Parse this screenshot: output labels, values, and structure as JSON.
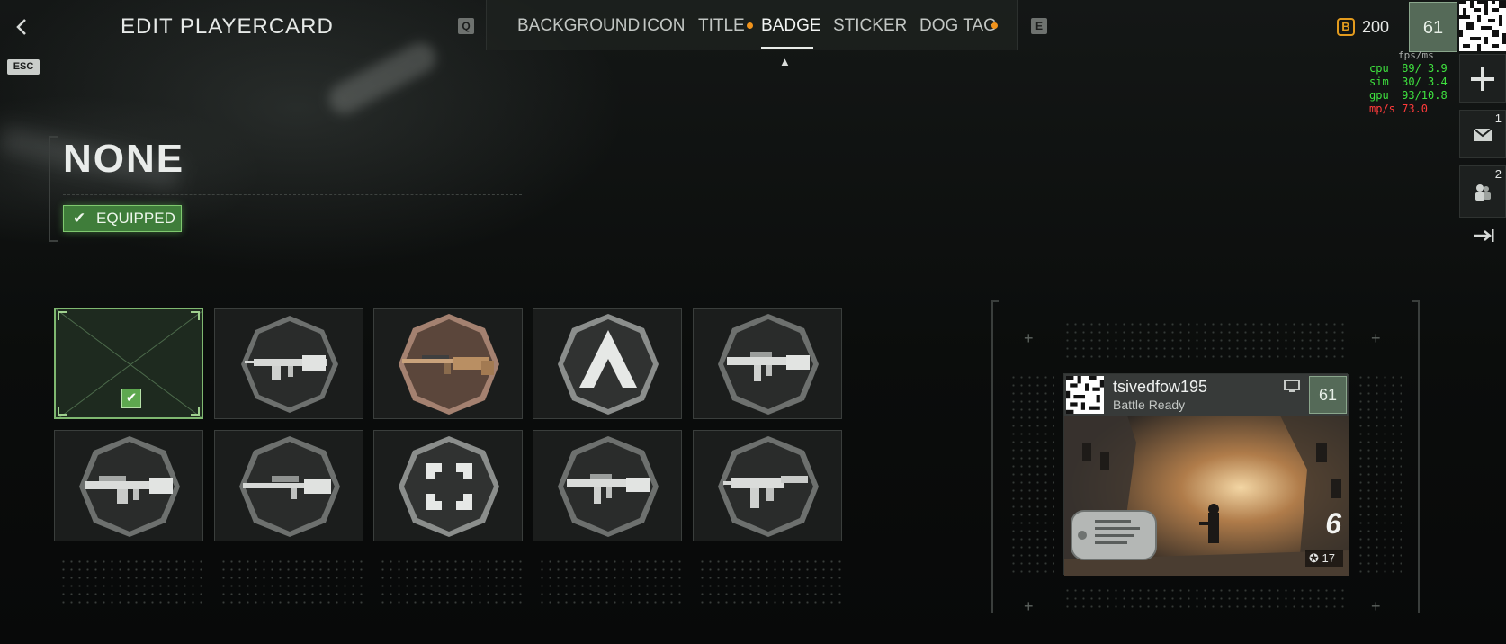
{
  "header": {
    "back_icon": "chevron-left-icon",
    "esc_key": "ESC",
    "title": "EDIT PLAYERCARD",
    "prev_key": "Q",
    "next_key": "E",
    "tabs": [
      {
        "label": "BACKGROUND",
        "has_dot": false,
        "active": false
      },
      {
        "label": "ICON",
        "has_dot": false,
        "active": false
      },
      {
        "label": "TITLE",
        "has_dot": true,
        "active": false
      },
      {
        "label": "BADGE",
        "has_dot": false,
        "active": true
      },
      {
        "label": "STICKER",
        "has_dot": false,
        "active": false
      },
      {
        "label": "DOG TAG",
        "has_dot": true,
        "active": false
      }
    ],
    "currency_icon": "B",
    "currency_value": "200",
    "level": "61"
  },
  "debug": {
    "fps_label": "fps/ms",
    "cpu": "cpu  89/ 3.9",
    "sim": "sim  30/ 3.4",
    "gpu": "gpu  93/10.8",
    "mps": "mp/s 73.0"
  },
  "rail": {
    "mail_count": "1",
    "group_count": "2"
  },
  "selected": {
    "name": "NONE",
    "status": "EQUIPPED"
  },
  "badges": [
    {
      "id": "none",
      "type": "empty",
      "selected": true
    },
    {
      "id": "badge-2",
      "type": "rifle-long",
      "tint": "silver"
    },
    {
      "id": "badge-3",
      "type": "rifle-wood",
      "tint": "bronze"
    },
    {
      "id": "badge-4",
      "type": "chevron",
      "tint": "silver"
    },
    {
      "id": "badge-5",
      "type": "rifle-carbine",
      "tint": "silver"
    },
    {
      "id": "badge-6",
      "type": "rifle-lmg",
      "tint": "silver"
    },
    {
      "id": "badge-7",
      "type": "rifle-sniper",
      "tint": "silver"
    },
    {
      "id": "badge-8",
      "type": "brackets",
      "tint": "silver"
    },
    {
      "id": "badge-9",
      "type": "rifle-carbine",
      "tint": "silver"
    },
    {
      "id": "badge-10",
      "type": "smg",
      "tint": "silver"
    }
  ],
  "card": {
    "player_name": "tsivedfow195",
    "subtitle": "Battle Ready",
    "level": "61",
    "kills_number": "6",
    "kills_count": "17"
  },
  "colors": {
    "accent_green": "#5ea84f",
    "notification_orange": "#f1931b",
    "currency_gold": "#e39b1e",
    "level_green": "#556a58"
  }
}
